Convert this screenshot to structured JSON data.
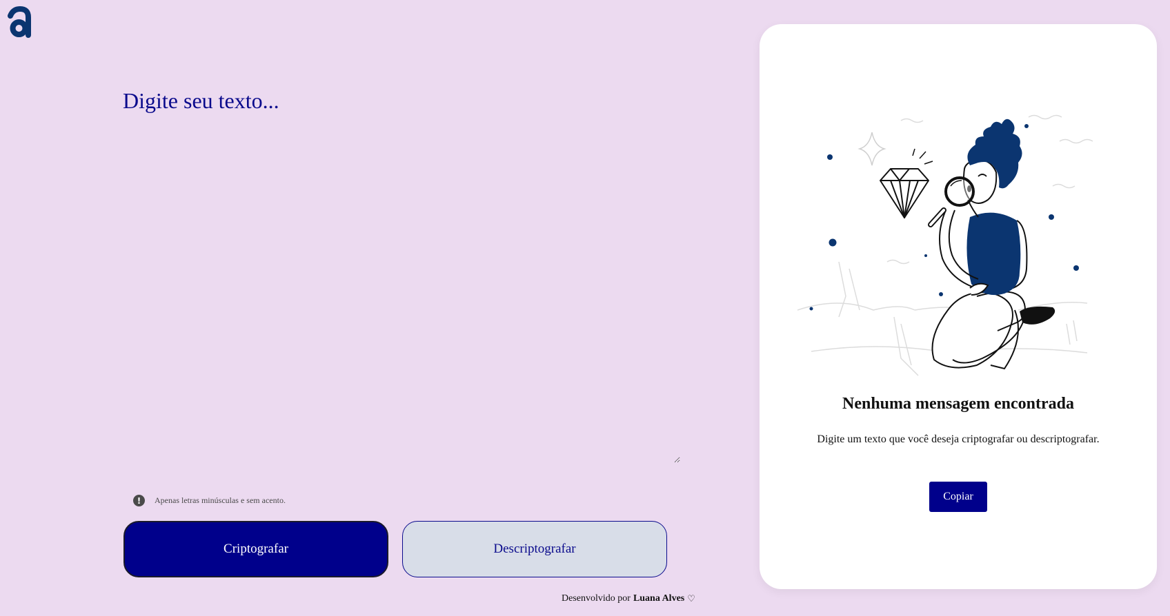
{
  "logo": {
    "icon": "alura-a-logo-icon",
    "color": "#0b3570"
  },
  "input": {
    "placeholder": "Digite seu texto..."
  },
  "hint": {
    "icon": "exclamation-circle-icon",
    "text": "Apenas letras minúsculas e sem acento."
  },
  "buttons": {
    "encrypt_label": "Criptografar",
    "decrypt_label": "Descriptografar"
  },
  "footer": {
    "prefix": "Desenvolvido por",
    "author": "Luana Alves",
    "icon": "heart-outline-icon"
  },
  "output_panel": {
    "illustration": "person-magnifying-glass-diamond-illustration",
    "title": "Nenhuma mensagem encontrada",
    "text": "Digite um texto que você deseja criptografar ou descriptografar.",
    "copy_label": "Copiar"
  },
  "colors": {
    "background": "#ecdaf0",
    "primary": "#00008b",
    "secondary_button": "#d8dde8",
    "illustration_accent": "#0b3570"
  }
}
